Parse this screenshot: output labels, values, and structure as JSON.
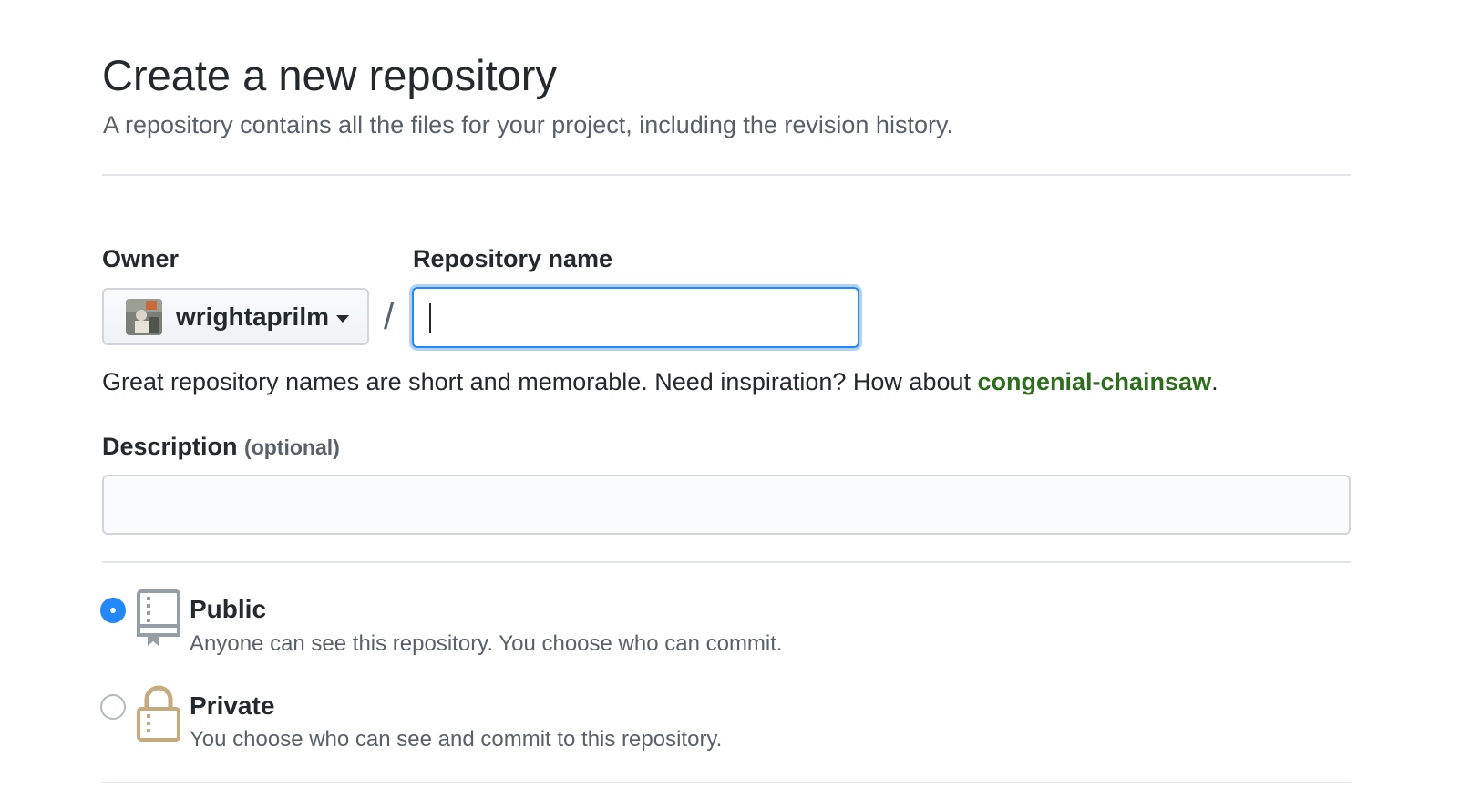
{
  "header": {
    "title": "Create a new repository",
    "subtitle": "A repository contains all the files for your project, including the revision history."
  },
  "owner": {
    "label": "Owner",
    "selected": "wrightaprilm"
  },
  "separator": "/",
  "repo_name": {
    "label": "Repository name",
    "value": "",
    "hint_prefix": "Great repository names are short and memorable. Need inspiration? How about ",
    "suggestion": "congenial-chainsaw",
    "hint_suffix": "."
  },
  "description": {
    "label": "Description",
    "optional_note": "(optional)",
    "value": ""
  },
  "visibility": {
    "options": [
      {
        "title": "Public",
        "description": "Anyone can see this repository. You choose who can commit.",
        "icon": "repo-book-icon",
        "checked": true
      },
      {
        "title": "Private",
        "description": "You choose who can see and commit to this repository.",
        "icon": "lock-icon",
        "checked": false
      }
    ]
  },
  "colors": {
    "accent_blue": "#2188ff",
    "suggestion_green": "#2c6e1b",
    "lock_gold": "#c3ab7e",
    "icon_gray": "#959da5"
  }
}
